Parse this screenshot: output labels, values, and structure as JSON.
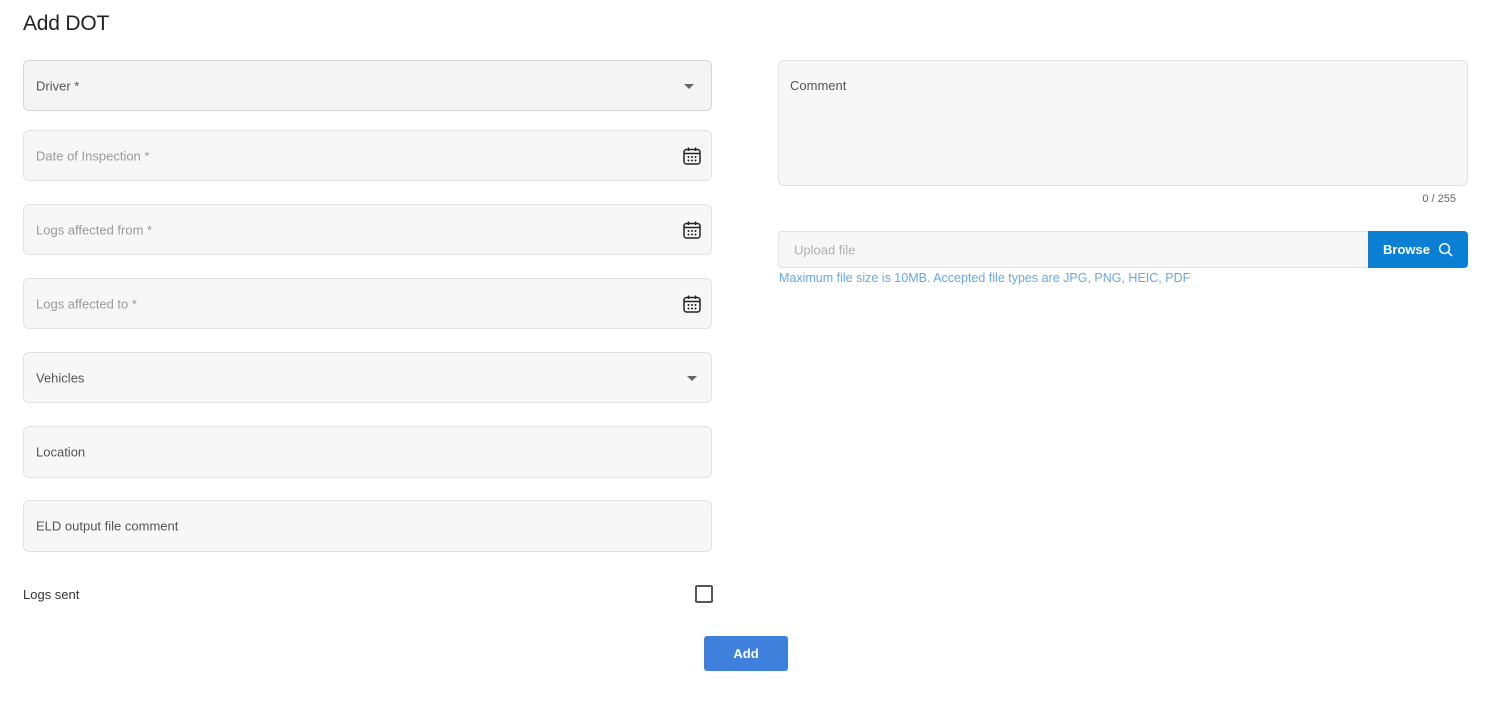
{
  "page": {
    "title": "Add DOT"
  },
  "form": {
    "driver": {
      "label": "Driver *",
      "icon": "chevron-down-icon"
    },
    "date_of_inspection": {
      "placeholder": "Date of Inspection *",
      "icon": "calendar-icon"
    },
    "logs_affected_from": {
      "placeholder": "Logs affected from *",
      "icon": "calendar-icon"
    },
    "logs_affected_to": {
      "placeholder": "Logs affected to *",
      "icon": "calendar-icon"
    },
    "vehicles": {
      "label": "Vehicles",
      "icon": "chevron-down-icon"
    },
    "location": {
      "label": "Location"
    },
    "eld_output_comment": {
      "label": "ELD output file comment"
    },
    "logs_sent": {
      "label": "Logs sent",
      "checked": false
    },
    "comment": {
      "label": "Comment",
      "counter": "0 / 255"
    },
    "upload": {
      "placeholder": "Upload file",
      "browse_label": "Browse",
      "browse_icon": "search-icon",
      "hint": "Maximum file size is 10MB. Accepted file types are JPG, PNG, HEIC, PDF"
    },
    "submit_label": "Add"
  },
  "colors": {
    "browse_button": "#0b7fd4",
    "add_button": "#3f80dc",
    "hint_text": "#6aa8dc",
    "field_bg": "#f7f7f7"
  }
}
